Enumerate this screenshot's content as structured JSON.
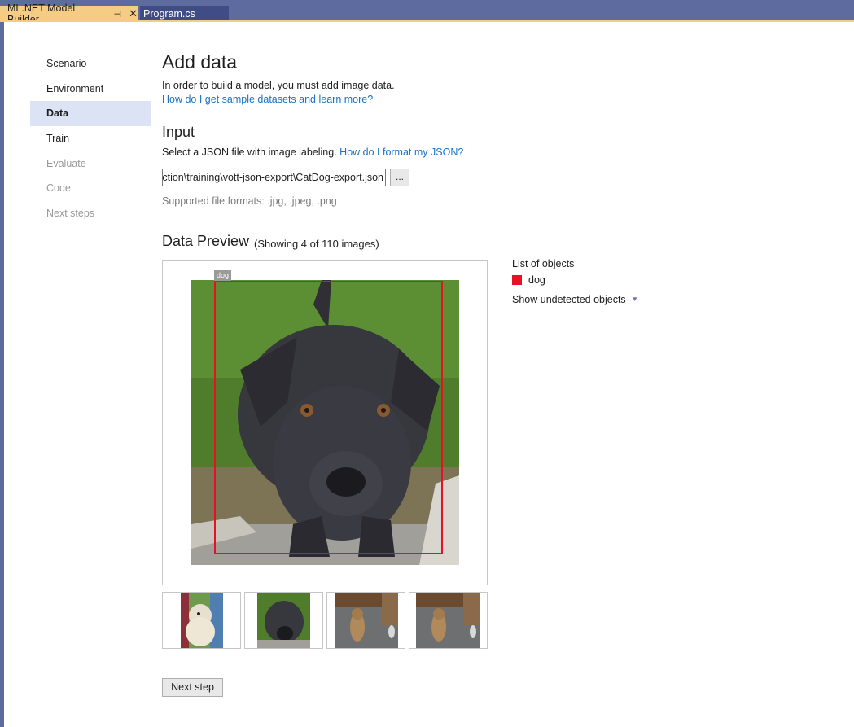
{
  "tabs": {
    "active": "ML.NET Model Builder",
    "inactive": "Program.cs"
  },
  "nav": {
    "items": [
      {
        "label": "Scenario"
      },
      {
        "label": "Environment"
      },
      {
        "label": "Data"
      },
      {
        "label": "Train"
      },
      {
        "label": "Evaluate"
      },
      {
        "label": "Code"
      },
      {
        "label": "Next steps"
      }
    ]
  },
  "page": {
    "title": "Add data",
    "description": "In order to build a model, you must add image data.",
    "help_link": "How do I get sample datasets and learn more?"
  },
  "input": {
    "heading": "Input",
    "instruction": "Select a JSON file with image labeling.",
    "json_help_link": "How do I format my JSON?",
    "file_path": "ction\\training\\vott-json-export\\CatDog-export.json",
    "browse_label": "...",
    "formats_note": "Supported file formats: .jpg, .jpeg, .png"
  },
  "preview": {
    "heading": "Data Preview",
    "showing": "(Showing 4 of 110 images)",
    "bbox_label": "dog"
  },
  "objects": {
    "title": "List of objects",
    "items": [
      {
        "label": "dog",
        "color": "#e81123"
      }
    ],
    "undetected_label": "Show undetected objects"
  },
  "next_button": "Next step",
  "colors": {
    "chrome": "#5d6b9e",
    "active_tab": "#f5cc84",
    "nav_active": "#dce3f4",
    "link": "#1a73c4",
    "bbox": "#e81123"
  }
}
